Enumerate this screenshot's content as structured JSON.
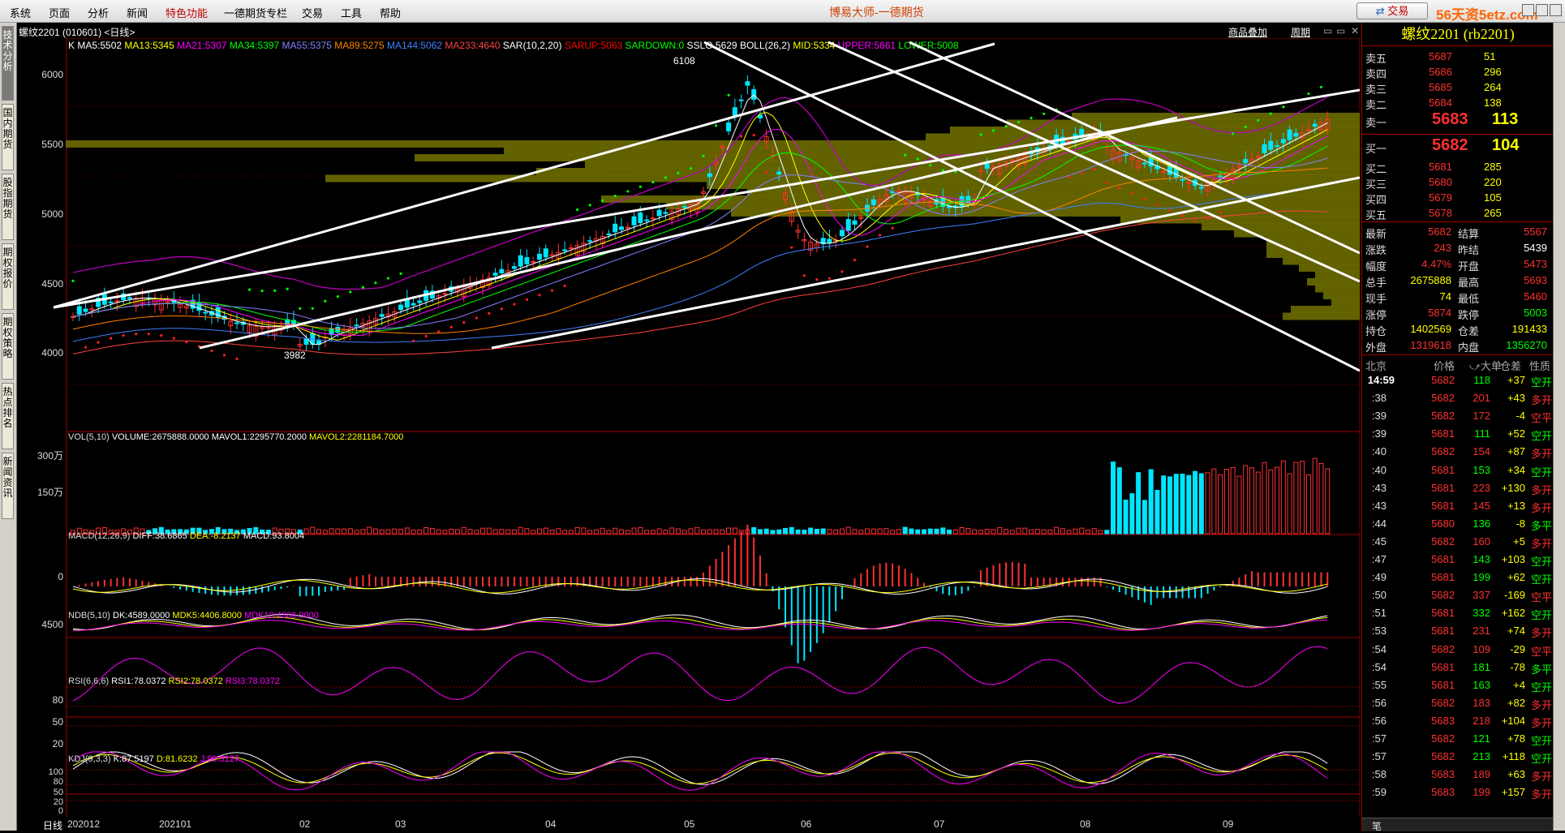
{
  "menu": [
    "系统",
    "页面",
    "分析",
    "新闻",
    "特色功能",
    "一德期货专栏",
    "交易",
    "工具",
    "帮助"
  ],
  "app_title": "博易大师-一德期货",
  "trade_button": "交易",
  "watermark": "56天资5etz.com",
  "left_tabs": [
    "技术分析",
    "国内期货",
    "股指期货",
    "期权报价",
    "期权策略",
    "热点排名",
    "新闻资讯"
  ],
  "chart_header": {
    "symbol": "螺纹2201 (010601) <日线>",
    "toolbar": [
      "商品叠加",
      "周期"
    ],
    "indicators": [
      {
        "text": "K",
        "color": "#ffffff"
      },
      {
        "text": "MA5:5502",
        "color": "#ffffff"
      },
      {
        "text": "MA13:5345",
        "color": "#ffff00"
      },
      {
        "text": "MA21:5307",
        "color": "#ff00ff"
      },
      {
        "text": "MA34:5397",
        "color": "#00ff00"
      },
      {
        "text": "MA55:5375",
        "color": "#8080ff"
      },
      {
        "text": "MA89:5275",
        "color": "#ff8000"
      },
      {
        "text": "MA144:5062",
        "color": "#4080ff"
      },
      {
        "text": "MA233:4640",
        "color": "#ff4040"
      },
      {
        "text": "SAR(10,2,20)",
        "color": "#ffffff"
      },
      {
        "text": "SARUP:5063",
        "color": "#ff0000"
      },
      {
        "text": "SARDOWN:0",
        "color": "#00ff00"
      },
      {
        "text": "SSLO 5629",
        "color": "#ffffff"
      },
      {
        "text": "BOLL(26,2)",
        "color": "#ffffff"
      },
      {
        "text": "MID:5334",
        "color": "#ffff00"
      },
      {
        "text": "UPPER:5661",
        "color": "#ff00ff"
      },
      {
        "text": "LOWER:5008",
        "color": "#00ff00"
      }
    ]
  },
  "price_axis": [
    "6000",
    "5500",
    "5000",
    "4500",
    "4000"
  ],
  "price_annotations": {
    "high": "6108",
    "low": "3982"
  },
  "vol_panel": {
    "label": "VOL(5,10)",
    "items": [
      {
        "text": "VOLUME:2675888.0000",
        "color": "#ffffff"
      },
      {
        "text": "MAVOL1:2295770.2000",
        "color": "#ffffff"
      },
      {
        "text": "MAVOL2:2281184.7000",
        "color": "#ffff00"
      }
    ],
    "axis": [
      "300万",
      "150万"
    ]
  },
  "macd_panel": {
    "label": "MACD(12,26,9)",
    "items": [
      {
        "text": "DIFF:38.6865",
        "color": "#ffffff"
      },
      {
        "text": "DEA:-8.2137",
        "color": "#ffff00"
      },
      {
        "text": "MACD:93.8004",
        "color": "#ffffff"
      }
    ],
    "axis": [
      "0"
    ]
  },
  "ndb_panel": {
    "label": "NDB(5,10)",
    "items": [
      {
        "text": "DK:4589.0000",
        "color": "#ffffff"
      },
      {
        "text": "MDK5:4406.8000",
        "color": "#ffff00"
      },
      {
        "text": "MDK10:4306.9000",
        "color": "#ff00ff"
      }
    ],
    "axis": [
      "4500"
    ]
  },
  "rsi_panel": {
    "label": "RSI(6,6,6)",
    "items": [
      {
        "text": "RSI1:78.0372",
        "color": "#ffffff"
      },
      {
        "text": "RSI2:78.0372",
        "color": "#ffff00"
      },
      {
        "text": "RSI3:78.0372",
        "color": "#ff00ff"
      }
    ],
    "axis": [
      "80",
      "50",
      "20"
    ]
  },
  "kdj_panel": {
    "label": "KDJ(9,3,3)",
    "items": [
      {
        "text": "K:87.5197",
        "color": "#ffffff"
      },
      {
        "text": "D:81.6232",
        "color": "#ffff00"
      },
      {
        "text": "J:99.3127",
        "color": "#ff00ff"
      }
    ],
    "axis": [
      "100",
      "80",
      "50",
      "20",
      "0"
    ]
  },
  "x_axis": {
    "period": "日线",
    "labels": [
      "202012",
      "202101",
      "02",
      "03",
      "04",
      "05",
      "06",
      "07",
      "08",
      "09"
    ]
  },
  "quote": {
    "title": "螺纹2201 (rb2201)",
    "asks": [
      {
        "label": "卖五",
        "price": "5687",
        "vol": "51"
      },
      {
        "label": "卖四",
        "price": "5686",
        "vol": "296"
      },
      {
        "label": "卖三",
        "price": "5685",
        "vol": "264"
      },
      {
        "label": "卖二",
        "price": "5684",
        "vol": "138"
      },
      {
        "label": "卖一",
        "price": "5683",
        "vol": "113"
      }
    ],
    "bids": [
      {
        "label": "买一",
        "price": "5682",
        "vol": "104"
      },
      {
        "label": "买二",
        "price": "5681",
        "vol": "285"
      },
      {
        "label": "买三",
        "price": "5680",
        "vol": "220"
      },
      {
        "label": "买四",
        "price": "5679",
        "vol": "105"
      },
      {
        "label": "买五",
        "price": "5678",
        "vol": "265"
      }
    ],
    "stats": [
      {
        "l1": "最新",
        "v1": "5682",
        "c1": "#ff3030",
        "l2": "结算",
        "v2": "5567",
        "c2": "#ff3030"
      },
      {
        "l1": "涨跌",
        "v1": "243",
        "c1": "#ff3030",
        "l2": "昨结",
        "v2": "5439",
        "c2": "#ffffff"
      },
      {
        "l1": "幅度",
        "v1": "4.47%",
        "c1": "#ff3030",
        "l2": "开盘",
        "v2": "5473",
        "c2": "#ff3030"
      },
      {
        "l1": "总手",
        "v1": "2675888",
        "c1": "#ffff00",
        "l2": "最高",
        "v2": "5693",
        "c2": "#ff3030"
      },
      {
        "l1": "现手",
        "v1": "74",
        "c1": "#ffff00",
        "l2": "最低",
        "v2": "5460",
        "c2": "#ff3030"
      },
      {
        "l1": "涨停",
        "v1": "5874",
        "c1": "#ff3030",
        "l2": "跌停",
        "v2": "5003",
        "c2": "#00ff00"
      },
      {
        "l1": "持仓",
        "v1": "1402569",
        "c1": "#ffff00",
        "l2": "仓差",
        "v2": "191433",
        "c2": "#ffff00"
      },
      {
        "l1": "外盘",
        "v1": "1319618",
        "c1": "#ff3030",
        "l2": "内盘",
        "v2": "1356270",
        "c2": "#00ff00"
      }
    ],
    "tick_header": {
      "time": "北京",
      "price": "价格",
      "vol": "⤻大单",
      "oi": "仓差",
      "nature": "性质"
    },
    "ticks": [
      {
        "t": "14:59",
        "p": "5682",
        "v": "118",
        "oi": "+37",
        "n": "空开",
        "pc": "#ff3030",
        "vc": "#00ff00",
        "nc": "#00ff00"
      },
      {
        "t": ":38",
        "p": "5682",
        "v": "201",
        "oi": "+43",
        "n": "多开",
        "pc": "#ff3030",
        "vc": "#ff3030",
        "nc": "#ff3030"
      },
      {
        "t": ":39",
        "p": "5682",
        "v": "172",
        "oi": "-4",
        "n": "空平",
        "pc": "#ff3030",
        "vc": "#ff3030",
        "nc": "#ff3030"
      },
      {
        "t": ":39",
        "p": "5681",
        "v": "111",
        "oi": "+52",
        "n": "空开",
        "pc": "#ff3030",
        "vc": "#00ff00",
        "nc": "#00ff00"
      },
      {
        "t": ":40",
        "p": "5682",
        "v": "154",
        "oi": "+87",
        "n": "多开",
        "pc": "#ff3030",
        "vc": "#ff3030",
        "nc": "#ff3030"
      },
      {
        "t": ":40",
        "p": "5681",
        "v": "153",
        "oi": "+34",
        "n": "空开",
        "pc": "#ff3030",
        "vc": "#00ff00",
        "nc": "#00ff00"
      },
      {
        "t": ":43",
        "p": "5681",
        "v": "223",
        "oi": "+130",
        "n": "多开",
        "pc": "#ff3030",
        "vc": "#ff3030",
        "nc": "#ff3030"
      },
      {
        "t": ":43",
        "p": "5681",
        "v": "145",
        "oi": "+13",
        "n": "多开",
        "pc": "#ff3030",
        "vc": "#ff3030",
        "nc": "#ff3030"
      },
      {
        "t": ":44",
        "p": "5680",
        "v": "136",
        "oi": "-8",
        "n": "多平",
        "pc": "#ff3030",
        "vc": "#00ff00",
        "nc": "#00ff00"
      },
      {
        "t": ":45",
        "p": "5682",
        "v": "160",
        "oi": "+5",
        "n": "多开",
        "pc": "#ff3030",
        "vc": "#ff3030",
        "nc": "#ff3030"
      },
      {
        "t": ":47",
        "p": "5681",
        "v": "143",
        "oi": "+103",
        "n": "空开",
        "pc": "#ff3030",
        "vc": "#00ff00",
        "nc": "#00ff00"
      },
      {
        "t": ":49",
        "p": "5681",
        "v": "199",
        "oi": "+62",
        "n": "空开",
        "pc": "#ff3030",
        "vc": "#00ff00",
        "nc": "#00ff00"
      },
      {
        "t": ":50",
        "p": "5682",
        "v": "337",
        "oi": "-169",
        "n": "空平",
        "pc": "#ff3030",
        "vc": "#ff3030",
        "nc": "#ff3030"
      },
      {
        "t": ":51",
        "p": "5681",
        "v": "332",
        "oi": "+162",
        "n": "空开",
        "pc": "#ff3030",
        "vc": "#00ff00",
        "nc": "#00ff00"
      },
      {
        "t": ":53",
        "p": "5681",
        "v": "231",
        "oi": "+74",
        "n": "多开",
        "pc": "#ff3030",
        "vc": "#ff3030",
        "nc": "#ff3030"
      },
      {
        "t": ":54",
        "p": "5682",
        "v": "109",
        "oi": "-29",
        "n": "空平",
        "pc": "#ff3030",
        "vc": "#ff3030",
        "nc": "#ff3030"
      },
      {
        "t": ":54",
        "p": "5681",
        "v": "181",
        "oi": "-78",
        "n": "多平",
        "pc": "#ff3030",
        "vc": "#00ff00",
        "nc": "#00ff00"
      },
      {
        "t": ":55",
        "p": "5681",
        "v": "163",
        "oi": "+4",
        "n": "空开",
        "pc": "#ff3030",
        "vc": "#00ff00",
        "nc": "#00ff00"
      },
      {
        "t": ":56",
        "p": "5682",
        "v": "183",
        "oi": "+82",
        "n": "多开",
        "pc": "#ff3030",
        "vc": "#ff3030",
        "nc": "#ff3030"
      },
      {
        "t": ":56",
        "p": "5683",
        "v": "218",
        "oi": "+104",
        "n": "多开",
        "pc": "#ff3030",
        "vc": "#ff3030",
        "nc": "#ff3030"
      },
      {
        "t": ":57",
        "p": "5682",
        "v": "121",
        "oi": "+78",
        "n": "空开",
        "pc": "#ff3030",
        "vc": "#00ff00",
        "nc": "#00ff00"
      },
      {
        "t": ":57",
        "p": "5682",
        "v": "213",
        "oi": "+118",
        "n": "空开",
        "pc": "#ff3030",
        "vc": "#00ff00",
        "nc": "#00ff00"
      },
      {
        "t": ":58",
        "p": "5683",
        "v": "189",
        "oi": "+63",
        "n": "多开",
        "pc": "#ff3030",
        "vc": "#ff3030",
        "nc": "#ff3030"
      },
      {
        "t": ":59",
        "p": "5683",
        "v": "199",
        "oi": "+157",
        "n": "多开",
        "pc": "#ff3030",
        "vc": "#ff3030",
        "nc": "#ff3030"
      }
    ],
    "footer_tab": "笔"
  }
}
